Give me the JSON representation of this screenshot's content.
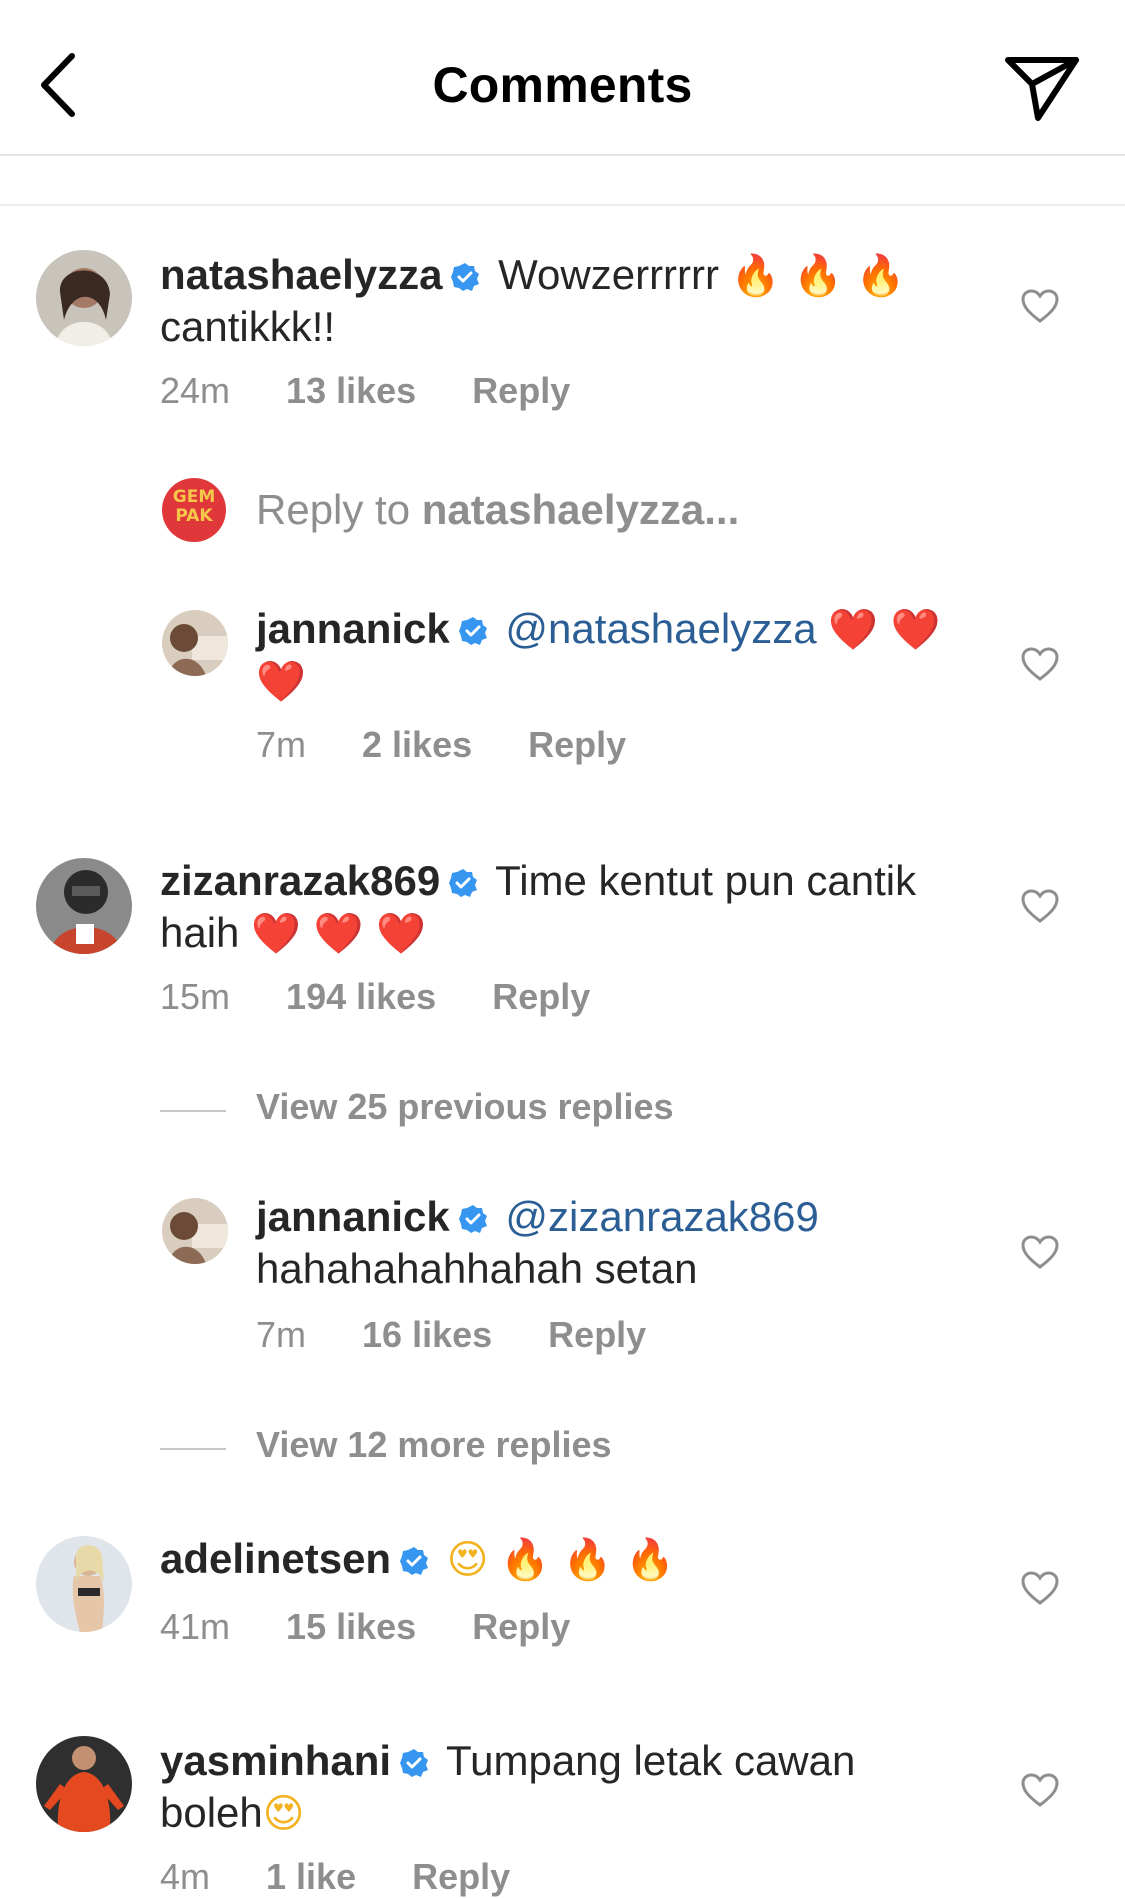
{
  "header": {
    "title": "Comments",
    "back_icon": "chevron-left-icon",
    "send_icon": "paper-plane-icon"
  },
  "comments": [
    {
      "username": "natashaelyzza",
      "verified": true,
      "text": "Wowzerrrrrr",
      "emoji": "🔥 🔥 🔥",
      "text2": "cantikkk!!",
      "time": "24m",
      "likes": "13 likes",
      "reply": "Reply"
    },
    {
      "username": "zizanrazak869",
      "verified": true,
      "text": "Time kentut pun cantik",
      "text2": "haih",
      "emoji": "❤️ ❤️ ❤️",
      "time": "15m",
      "likes": "194 likes",
      "reply": "Reply"
    },
    {
      "username": "adelinetsen",
      "verified": true,
      "emoji_face": "😍",
      "emoji": "🔥 🔥 🔥",
      "time": "41m",
      "likes": "15 likes",
      "reply": "Reply"
    },
    {
      "username": "yasminhani",
      "verified": true,
      "text": "Tumpang letak cawan",
      "text2": "boleh",
      "emoji": "😍",
      "time": "4m",
      "likes": "1 like",
      "reply": "Reply"
    }
  ],
  "reply_prompt": {
    "avatar_text": "GEM PAK",
    "prefix": "Reply to",
    "target": "natashaelyzza..."
  },
  "replies": [
    {
      "username": "jannanick",
      "verified": true,
      "mention": "@natashaelyzza",
      "emoji": "❤️ ❤️",
      "emoji2": "❤️",
      "time": "7m",
      "likes": "2 likes",
      "reply": "Reply"
    },
    {
      "username": "jannanick",
      "verified": true,
      "mention": "@zizanrazak869",
      "text2": "hahahahahhahah setan",
      "time": "7m",
      "likes": "16 likes",
      "reply": "Reply"
    }
  ],
  "view_replies": [
    {
      "label": "View 25 previous replies"
    },
    {
      "label": "View 12 more replies"
    }
  ],
  "colors": {
    "accent_mention": "#2b5e94",
    "verified_badge": "#3797f0",
    "meta_gray": "#8e8e8e",
    "avatar_gempak": "#e0383a"
  }
}
